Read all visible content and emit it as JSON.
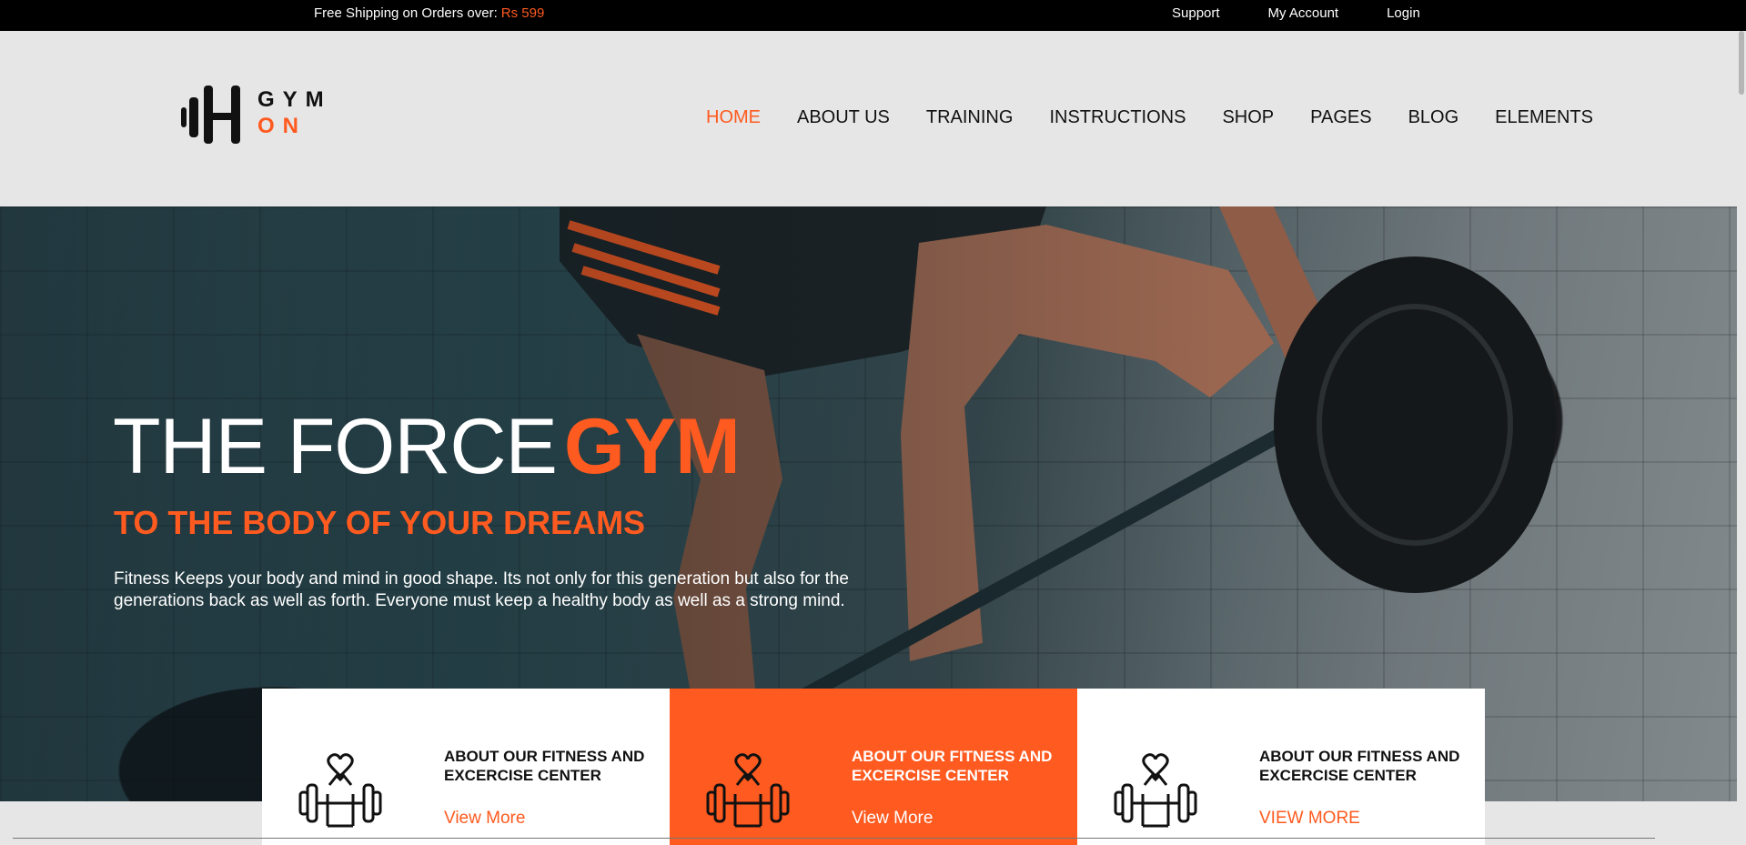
{
  "topbar": {
    "shipping_text": "Free Shipping on Orders over:",
    "shipping_price": "Rs 599",
    "links": [
      "Support",
      "My Account",
      "Login"
    ]
  },
  "logo": {
    "line1": "GYM",
    "line2": "ON",
    "icon": "dumbbell-icon"
  },
  "nav": {
    "items": [
      "HOME",
      "ABOUT US",
      "TRAINING",
      "INSTRUCTIONS",
      "SHOP",
      "PAGES",
      "BLOG",
      "ELEMENTS"
    ],
    "active": "HOME"
  },
  "hero": {
    "title_main": "THE FORCE",
    "title_accent": "GYM",
    "subtitle": "TO THE BODY OF YOUR DREAMS",
    "description": "Fitness Keeps your body and mind in good shape. Its not only for this generation but also for the generations back as well as forth. Everyone must keep a healthy body as well as a strong mind."
  },
  "cards": [
    {
      "title": "ABOUT OUR FITNESS AND EXCERCISE CENTER",
      "link": "View More",
      "icon": "fitness-heart-icon"
    },
    {
      "title": "ABOUT OUR FITNESS AND EXCERCISE CENTER",
      "link": "View More",
      "icon": "fitness-heart-icon"
    },
    {
      "title": "ABOUT OUR FITNESS AND EXCERCISE CENTER",
      "link": "VIEW MORE",
      "icon": "fitness-heart-icon"
    }
  ],
  "colors": {
    "accent": "#ff5a1f",
    "topbar": "#000000",
    "header_bg": "#e6e6e6"
  }
}
